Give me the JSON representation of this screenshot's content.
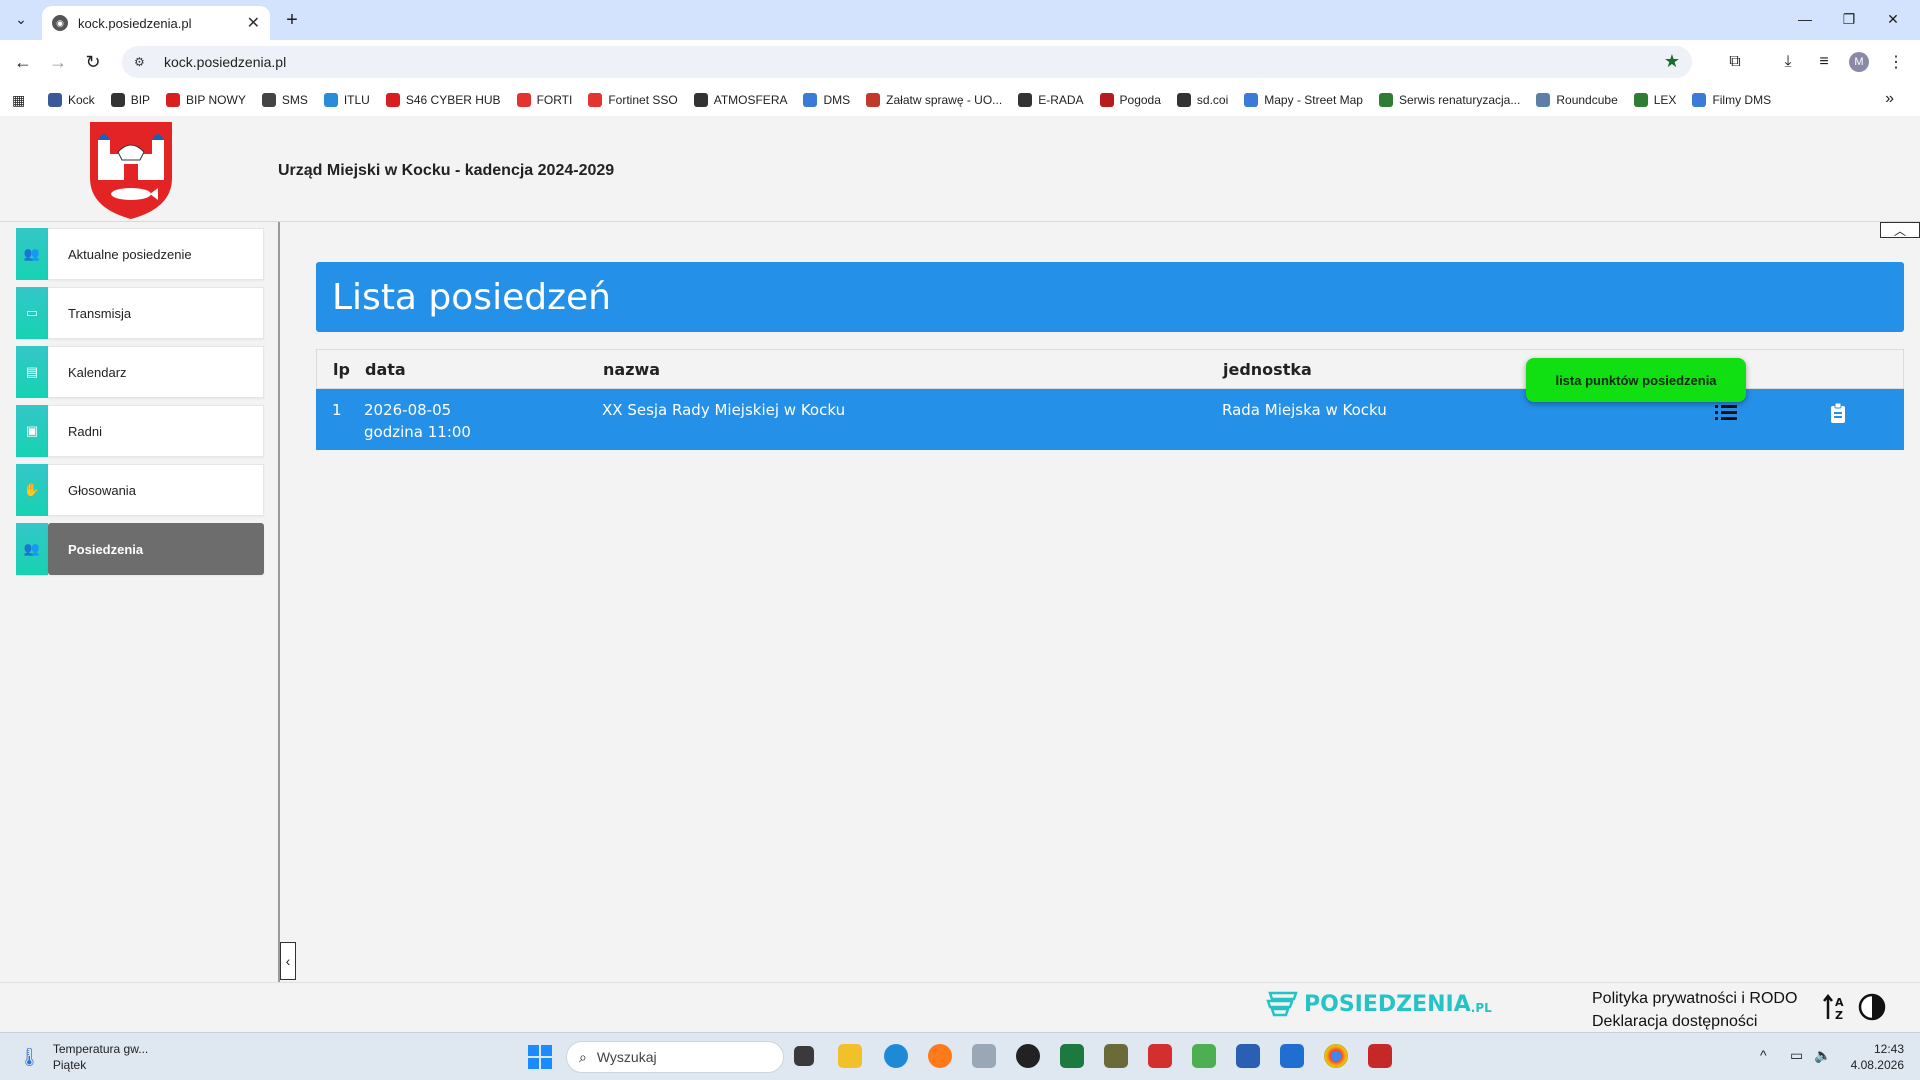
{
  "browser": {
    "tab_title": "kock.posiedzenia.pl",
    "url": "kock.posiedzenia.pl",
    "profile_initial": "M",
    "bookmarks": [
      {
        "label": "Kock",
        "color": "#3b5998"
      },
      {
        "label": "BIP",
        "color": "#333333"
      },
      {
        "label": "BIP NOWY",
        "color": "#d81e1e"
      },
      {
        "label": "SMS",
        "color": "#444444"
      },
      {
        "label": "ITLU",
        "color": "#2a8bd8"
      },
      {
        "label": "S46 CYBER HUB",
        "color": "#d81e1e"
      },
      {
        "label": "FORTI",
        "color": "#e3342f"
      },
      {
        "label": "Fortinet SSO",
        "color": "#e3342f"
      },
      {
        "label": "ATMOSFERA",
        "color": "#333333"
      },
      {
        "label": "DMS",
        "color": "#3a7bd5"
      },
      {
        "label": "Załatw sprawę - UO...",
        "color": "#c0392b"
      },
      {
        "label": "E-RADA",
        "color": "#333333"
      },
      {
        "label": "Pogoda",
        "color": "#b71c1c"
      },
      {
        "label": "sd.coi",
        "color": "#333333"
      },
      {
        "label": "Mapy - Street Map",
        "color": "#3a7bd5"
      },
      {
        "label": "Serwis renaturyzacja...",
        "color": "#2e7d32"
      },
      {
        "label": "Roundcube",
        "color": "#5b7fa6"
      },
      {
        "label": "LEX",
        "color": "#2e7d32"
      },
      {
        "label": "Filmy DMS",
        "color": "#3a7bd5"
      }
    ]
  },
  "header": {
    "title": "Urząd Miejski w Kocku - kadencja 2024-2029"
  },
  "sidebar": {
    "items": [
      {
        "label": "Aktualne posiedzenie",
        "icon": "people-icon"
      },
      {
        "label": "Transmisja",
        "icon": "video-icon"
      },
      {
        "label": "Kalendarz",
        "icon": "calendar-icon"
      },
      {
        "label": "Radni",
        "icon": "id-card-icon"
      },
      {
        "label": "Głosowania",
        "icon": "hand-icon"
      },
      {
        "label": "Posiedzenia",
        "icon": "people-icon"
      }
    ],
    "active": "Posiedzenia"
  },
  "main": {
    "title": "Lista posiedzeń",
    "columns": [
      "lp",
      "data",
      "nazwa",
      "jednostka"
    ],
    "rows": [
      {
        "lp": "1",
        "date": "2026-08-05",
        "time": "godzina 11:00",
        "name": "XX Sesja Rady Miejskiej w Kocku",
        "unit": "Rada Miejska w Kocku"
      }
    ],
    "tooltip": "lista punktów posiedzenia"
  },
  "footer": {
    "brand": "POSIEDZENIA",
    "brand_suffix": ".PL",
    "privacy_link": "Polityka prywatności i RODO",
    "accessibility_link": "Deklaracja dostępności"
  },
  "taskbar": {
    "weather_title": "Temperatura gw...",
    "weather_day": "Piątek",
    "search_placeholder": "Wyszukaj",
    "time": "12:43",
    "date": "4.08.2026"
  },
  "colors": {
    "accent_blue": "#2590e8",
    "sidebar_teal": "#1fcfb8",
    "tooltip_green": "#10e012",
    "brand_teal": "#26c3c6"
  }
}
